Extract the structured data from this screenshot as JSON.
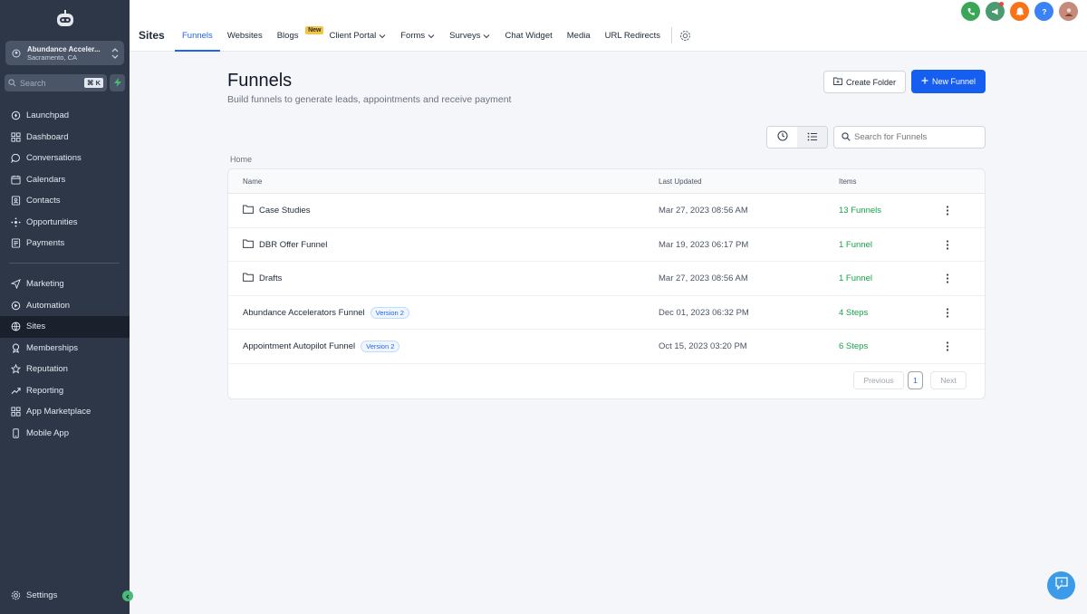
{
  "sidebar": {
    "account": {
      "name": "Abundance Acceler...",
      "location": "Sacramento, CA"
    },
    "search": {
      "placeholder": "Search",
      "shortcut": "⌘ K"
    },
    "items_primary": [
      {
        "label": "Launchpad",
        "icon": "rocket-icon"
      },
      {
        "label": "Dashboard",
        "icon": "grid-icon"
      },
      {
        "label": "Conversations",
        "icon": "chat-icon"
      },
      {
        "label": "Calendars",
        "icon": "calendar-icon"
      },
      {
        "label": "Contacts",
        "icon": "contacts-icon"
      },
      {
        "label": "Opportunities",
        "icon": "opportunities-icon"
      },
      {
        "label": "Payments",
        "icon": "payments-icon"
      }
    ],
    "items_secondary": [
      {
        "label": "Marketing",
        "icon": "send-icon"
      },
      {
        "label": "Automation",
        "icon": "automation-icon"
      },
      {
        "label": "Sites",
        "icon": "globe-icon",
        "active": true
      },
      {
        "label": "Memberships",
        "icon": "award-icon"
      },
      {
        "label": "Reputation",
        "icon": "star-icon"
      },
      {
        "label": "Reporting",
        "icon": "trend-icon"
      },
      {
        "label": "App Marketplace",
        "icon": "apps-icon"
      },
      {
        "label": "Mobile App",
        "icon": "phone-icon"
      }
    ],
    "settings_label": "Settings"
  },
  "topbar": {
    "section_title": "Sites",
    "tabs": [
      {
        "label": "Funnels",
        "active": true
      },
      {
        "label": "Websites"
      },
      {
        "label": "Blogs",
        "badge": "New"
      },
      {
        "label": "Client Portal",
        "dropdown": true
      },
      {
        "label": "Forms",
        "dropdown": true
      },
      {
        "label": "Surveys",
        "dropdown": true
      },
      {
        "label": "Chat Widget"
      },
      {
        "label": "Media"
      },
      {
        "label": "URL Redirects"
      }
    ],
    "icons": [
      {
        "name": "phone-call-icon",
        "color": "#3aa757"
      },
      {
        "name": "megaphone-icon",
        "color": "#4a9b6f"
      },
      {
        "name": "bell-icon",
        "color": "#f97316"
      },
      {
        "name": "help-icon",
        "color": "#3b82f6"
      },
      {
        "name": "user-avatar",
        "color": "#c58b7a"
      }
    ]
  },
  "main": {
    "title": "Funnels",
    "subtitle": "Build funnels to generate leads, appointments and receive payment",
    "create_folder_label": "Create Folder",
    "new_funnel_label": "New Funnel",
    "search_placeholder": "Search for Funnels",
    "breadcrumb": "Home",
    "columns": {
      "name": "Name",
      "updated": "Last Updated",
      "items": "Items"
    },
    "rows": [
      {
        "name": "Case Studies",
        "type": "folder",
        "updated": "Mar 27, 2023 08:56 AM",
        "items": "13 Funnels"
      },
      {
        "name": "DBR Offer Funnel",
        "type": "folder",
        "updated": "Mar 19, 2023 06:17 PM",
        "items": "1 Funnel"
      },
      {
        "name": "Drafts",
        "type": "folder",
        "updated": "Mar 27, 2023 08:56 AM",
        "items": "1 Funnel"
      },
      {
        "name": "Abundance Accelerators Funnel",
        "type": "funnel",
        "version": "Version 2",
        "updated": "Dec 01, 2023 06:32 PM",
        "items": "4 Steps"
      },
      {
        "name": "Appointment Autopilot Funnel",
        "type": "funnel",
        "version": "Version 2",
        "updated": "Oct 15, 2023 03:20 PM",
        "items": "6 Steps"
      }
    ],
    "pagination": {
      "previous": "Previous",
      "page": "1",
      "next": "Next"
    }
  },
  "colors": {
    "accent": "#155eef",
    "sidebar_bg": "#2d3748",
    "items_green": "#16a34a"
  }
}
